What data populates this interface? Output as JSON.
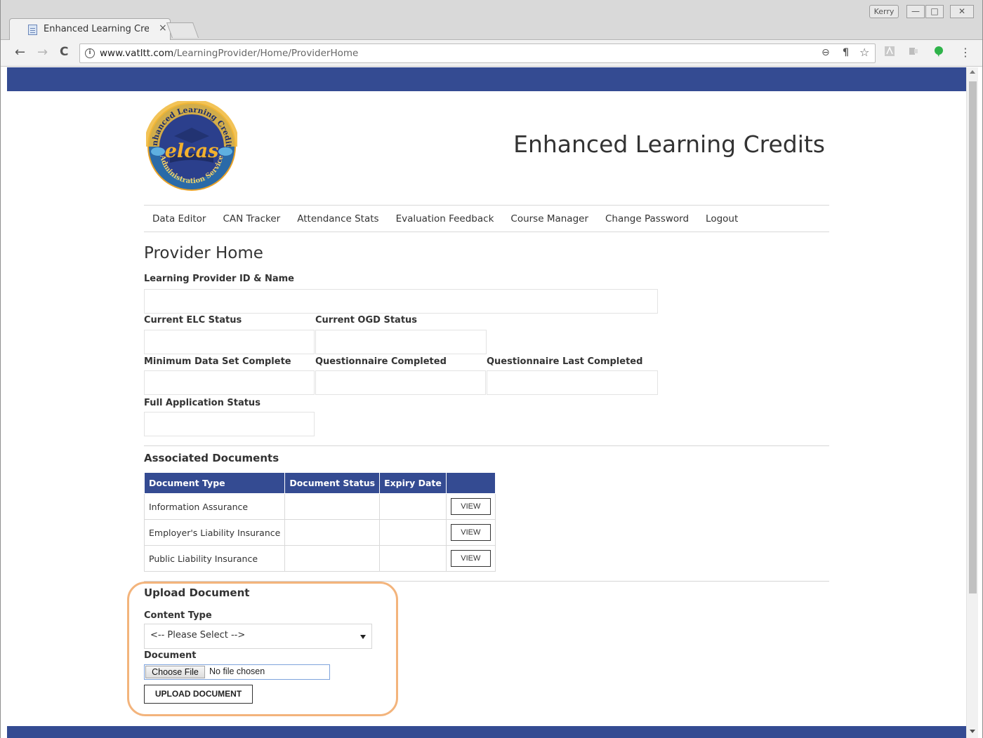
{
  "browser": {
    "tab_title": "Enhanced Learning Credi",
    "tab_close": "×",
    "user_name": "Kerry",
    "url_host": "www.vatltt.com",
    "url_path": "/LearningProvider/Home/ProviderHome",
    "back": "←",
    "forward": "→",
    "reload": "C",
    "zoom_icon": "⊖",
    "star_icon": "☆",
    "menu_icon": "⋮",
    "minimize": "—",
    "maximize": "□",
    "close": "✕",
    "brand_color": "#344b92"
  },
  "site": {
    "title": "Enhanced Learning Credits",
    "logo_text": "elcas",
    "logo_ring_top": "Enhanced Learning Credits",
    "logo_ring_bottom": "Administration Service"
  },
  "nav": {
    "items": [
      "Data Editor",
      "CAN Tracker",
      "Attendance Stats",
      "Evaluation Feedback",
      "Course Manager",
      "Change Password",
      "Logout"
    ]
  },
  "main": {
    "heading": "Provider Home",
    "labels": {
      "provider_id": "Learning Provider ID & Name",
      "elc_status": "Current ELC Status",
      "ogd_status": "Current OGD Status",
      "min_data": "Minimum Data Set Complete",
      "questionnaire_completed": "Questionnaire Completed",
      "questionnaire_last": "Questionnaire Last Completed",
      "full_app": "Full Application Status"
    }
  },
  "documents": {
    "heading": "Associated Documents",
    "columns": [
      "Document Type",
      "Document Status",
      "Expiry Date",
      ""
    ],
    "rows": [
      {
        "type": "Information Assurance",
        "status": "",
        "expiry": "",
        "action": "VIEW"
      },
      {
        "type": "Employer's Liability Insurance",
        "status": "",
        "expiry": "",
        "action": "VIEW"
      },
      {
        "type": "Public Liability Insurance",
        "status": "",
        "expiry": "",
        "action": "VIEW"
      }
    ]
  },
  "upload": {
    "heading": "Upload Document",
    "content_type_label": "Content Type",
    "content_type_value": "<-- Please Select -->",
    "document_label": "Document",
    "choose_file": "Choose File",
    "no_file": "No file chosen",
    "submit": "UPLOAD DOCUMENT"
  }
}
